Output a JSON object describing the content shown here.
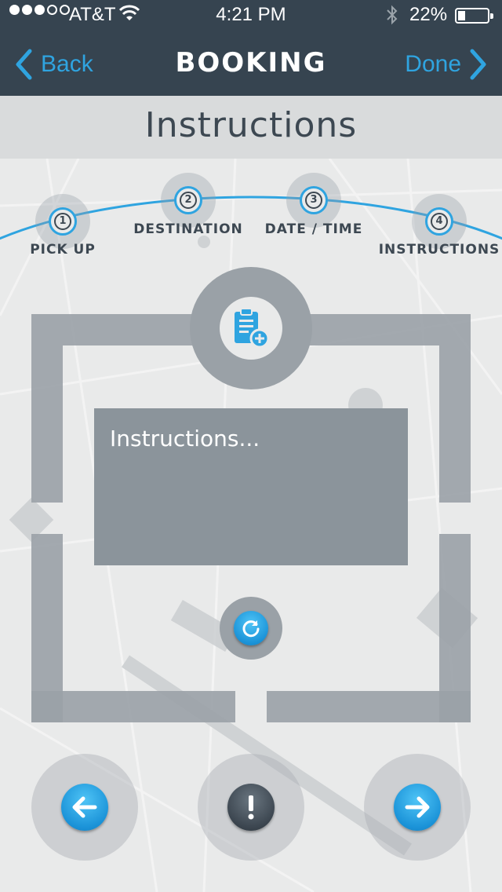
{
  "status_bar": {
    "carrier": "AT&T",
    "time": "4:21 PM",
    "battery": "22%",
    "battery_level": 0.22,
    "signal_bars": 3,
    "signal_total": 5
  },
  "nav": {
    "back_label": "Back",
    "title": "BOOKING",
    "done_label": "Done"
  },
  "page": {
    "heading": "Instructions"
  },
  "steps": [
    {
      "number": "1",
      "label": "PICK UP"
    },
    {
      "number": "2",
      "label": "DESTINATION"
    },
    {
      "number": "3",
      "label": "DATE / TIME"
    },
    {
      "number": "4",
      "label": "INSTRUCTIONS"
    }
  ],
  "instructions": {
    "placeholder": "Instructions..."
  },
  "icons": {
    "top": "clipboard-add-icon",
    "refresh": "refresh-icon",
    "prev": "arrow-left-icon",
    "alert": "exclamation-icon",
    "next": "arrow-right-icon"
  },
  "colors": {
    "accent": "#2fa4e0",
    "nav_bg": "#364450",
    "frame": "#9aa1a7",
    "text_dark": "#3d4852"
  }
}
